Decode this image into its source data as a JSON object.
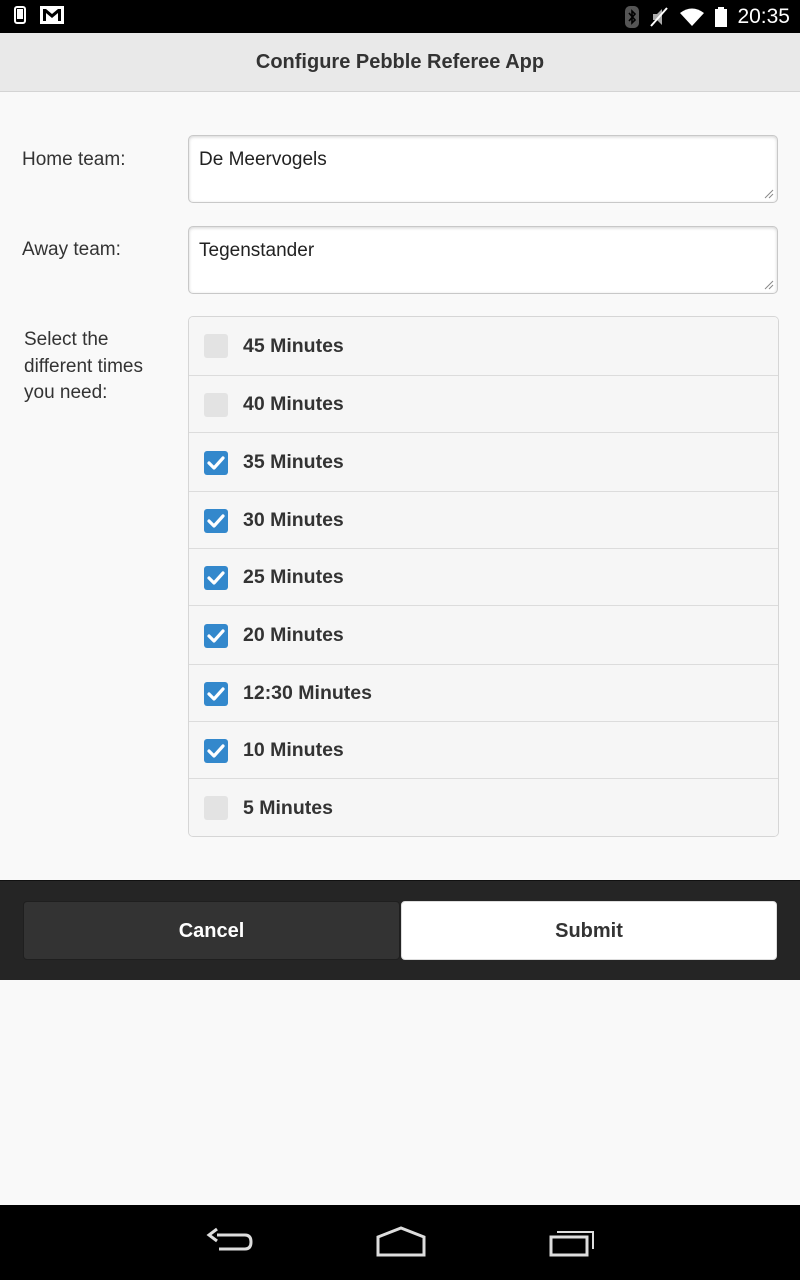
{
  "status_bar": {
    "left_icons": [
      "phone-icon",
      "gmail-icon"
    ],
    "right_icons": [
      "bluetooth-icon",
      "mute-icon",
      "wifi-icon",
      "battery-icon"
    ],
    "time": "20:35"
  },
  "header": {
    "title": "Configure Pebble Referee App"
  },
  "form": {
    "home": {
      "label": "Home team:",
      "value": "De Meervogels"
    },
    "away": {
      "label": "Away team:",
      "value": "Tegenstander"
    },
    "times": {
      "label": "Select the different times you need:",
      "options": [
        {
          "label": "45 Minutes",
          "checked": false
        },
        {
          "label": "40 Minutes",
          "checked": false
        },
        {
          "label": "35 Minutes",
          "checked": true
        },
        {
          "label": "30 Minutes",
          "checked": true
        },
        {
          "label": "25 Minutes",
          "checked": true
        },
        {
          "label": "20 Minutes",
          "checked": true
        },
        {
          "label": "12:30 Minutes",
          "checked": true
        },
        {
          "label": "10 Minutes",
          "checked": true
        },
        {
          "label": "5 Minutes",
          "checked": false
        }
      ]
    }
  },
  "footer": {
    "cancel_label": "Cancel",
    "submit_label": "Submit"
  },
  "nav_bar": {
    "icons": [
      "back-icon",
      "home-icon",
      "recents-icon"
    ]
  },
  "colors": {
    "checkbox_checked": "#3388cc",
    "checkbox_unchecked": "#e3e3e3"
  }
}
